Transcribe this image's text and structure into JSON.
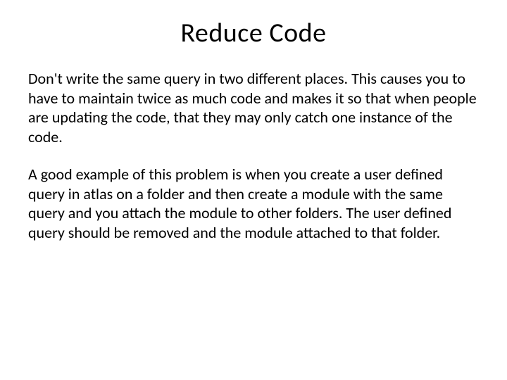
{
  "slide": {
    "title": "Reduce Code",
    "paragraph1": "Don't write the same query in two different places. This causes you to have to maintain twice as much code and makes it so that when people are updating the code, that they may only catch one instance of the code.",
    "paragraph2": "A good example of this problem is when you create a user defined query in atlas on a folder and then create a module with the same query and you attach the module to other folders. The user defined query should be removed and the module attached to that folder."
  }
}
